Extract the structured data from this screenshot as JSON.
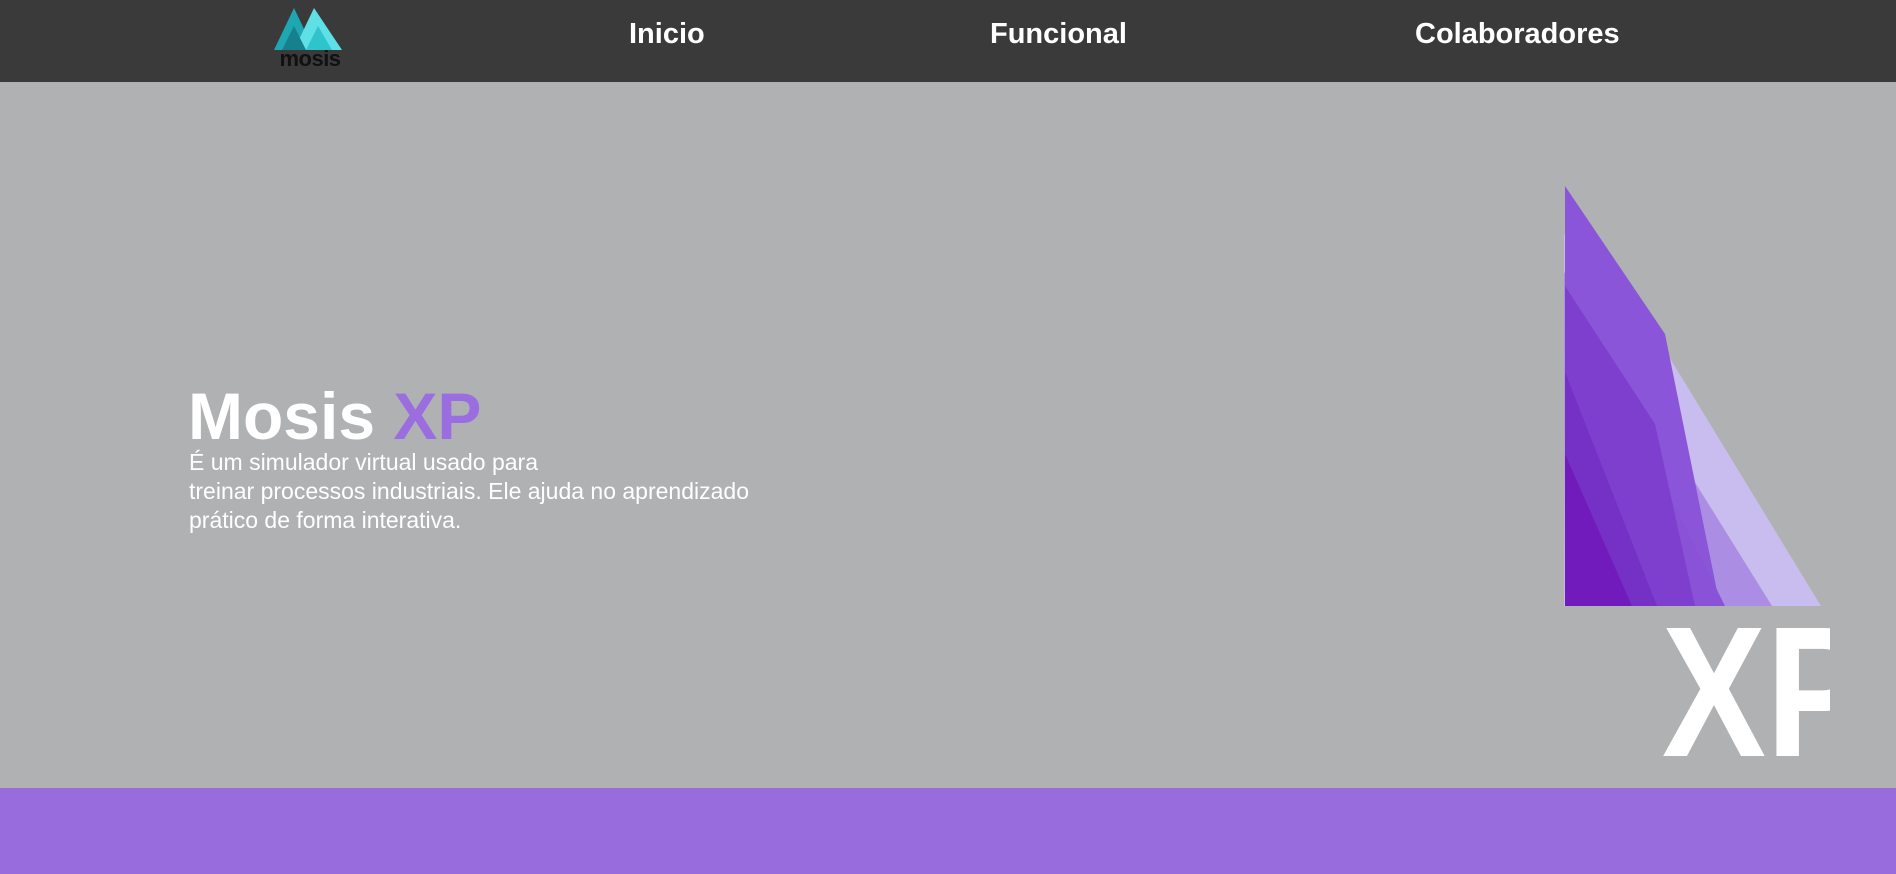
{
  "nav": {
    "logo_text": "mosis",
    "links": [
      {
        "label": "Inicio"
      },
      {
        "label": "Funcional"
      },
      {
        "label": "Colaboradores"
      }
    ]
  },
  "hero": {
    "title_main": "Mosis ",
    "title_accent": "XP",
    "description_lines": [
      "É um simulador virtual usado para",
      "treinar processos industriais. Ele ajuda no aprendizado",
      "prático de forma interativa."
    ],
    "graphic_text": "XP"
  },
  "colors": {
    "navbar_bg": "#3a3a3b",
    "hero_bg": "#b0b1b3",
    "accent": "#9a6de0",
    "bottom_band": "#986cdd",
    "logo_teal": "#2fc3cc"
  },
  "icons": {
    "nav_logo": "mosis-mountain-logo",
    "hero_graphic": "purple-mountains-xp-logo"
  }
}
